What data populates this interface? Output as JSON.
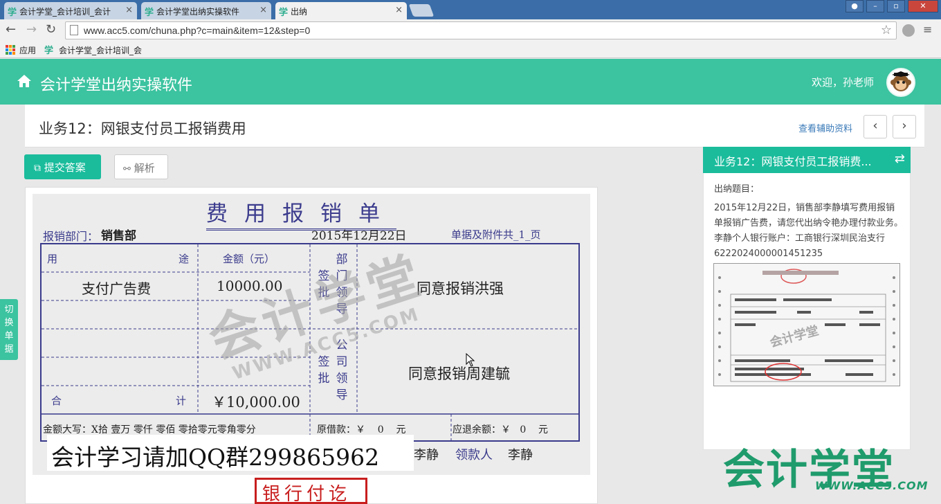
{
  "browser": {
    "tabs": [
      {
        "label": "会计学堂_会计培训_会计",
        "active": false
      },
      {
        "label": "会计学堂出纳实操软件",
        "active": false
      },
      {
        "label": "出纳",
        "active": true
      }
    ],
    "favicon_glyph": "学",
    "url": "www.acc5.com/chuna.php?c=main&item=12&step=0",
    "bookmarks": {
      "apps_label": "应用",
      "bookmark1": "会计学堂_会计培训_会"
    }
  },
  "header": {
    "app_title": "会计学堂出纳实操软件",
    "welcome": "欢迎，孙老师"
  },
  "task": {
    "title": "业务12：网银支付员工报销费用",
    "help_link": "查看辅助资料",
    "prev": "‹",
    "next": "›"
  },
  "actions": {
    "submit": "提交答案",
    "analysis": "解析"
  },
  "form": {
    "title": "费用报销单",
    "dept_label": "报销部门：",
    "dept_value": "销售部",
    "date": "2015年12月22日",
    "attachments": "单据及附件共_1_页",
    "col_purpose_left": "用",
    "col_purpose_right": "途",
    "col_amount": "金额（元）",
    "rows": [
      {
        "purpose": "支付广告费",
        "amount": "10000.00"
      },
      {
        "purpose": "",
        "amount": ""
      },
      {
        "purpose": "",
        "amount": ""
      },
      {
        "purpose": "",
        "amount": ""
      }
    ],
    "total_left": "合",
    "total_right": "计",
    "total_amount": "￥10,000.00",
    "sign_label_a": "签批",
    "dept_leader": "部门领导",
    "dept_opinion": "同意报销洪强",
    "sign_label_b": "签批",
    "company_leader": "公司领导",
    "company_opinion": "同意报销周建毓",
    "amount_words": "金额大写：X拾 壹万 零仟 零佰 零拾零元零角零分",
    "loan": "原借款：￥    0    元",
    "refund": "应退余额：￥   0    元",
    "handler_tail": "李静",
    "payee_label": "领款人",
    "payee_name": "李静"
  },
  "overlays": {
    "qq_banner": "会计学习请加QQ群299865962",
    "bank_stamp": "银行付讫"
  },
  "side": {
    "title": "业务12：网银支付员工报销费...",
    "label": "出纳题目：",
    "description": "2015年12月22日，销售部李静填写费用报销单报销广告费，请您代出纳令艳办理付款业务。李静个人银行账户：工商银行深圳民治支行6222024000001451235"
  },
  "switch_tab": "切换单据",
  "colors": {
    "accent": "#3cc3a0",
    "button": "#1abc9c",
    "stamp": "#c81e1e",
    "form_ink": "#3a3a8c"
  }
}
